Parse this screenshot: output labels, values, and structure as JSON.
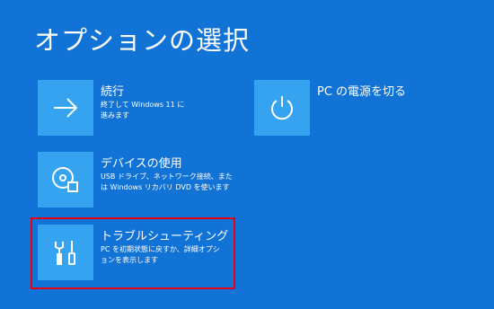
{
  "page": {
    "title": "オプションの選択"
  },
  "options": [
    {
      "title": "続行",
      "description": "終了して Windows 11 に進みます",
      "icon": "arrow-right-icon"
    },
    {
      "title": "デバイスの使用",
      "description": "USB ドライブ、ネットワーク接続、または Windows リカバリ DVD を使います",
      "icon": "disc-drive-icon"
    },
    {
      "title": "トラブルシューティング",
      "description": "PC を初期状態に戻すか、詳細オプションを表示します",
      "icon": "tools-icon"
    },
    {
      "title": "PC の電源を切る",
      "description": "",
      "icon": "power-icon"
    }
  ],
  "colors": {
    "background": "#1173d6",
    "tile": "#36a3f0",
    "highlight": "#e60012"
  }
}
